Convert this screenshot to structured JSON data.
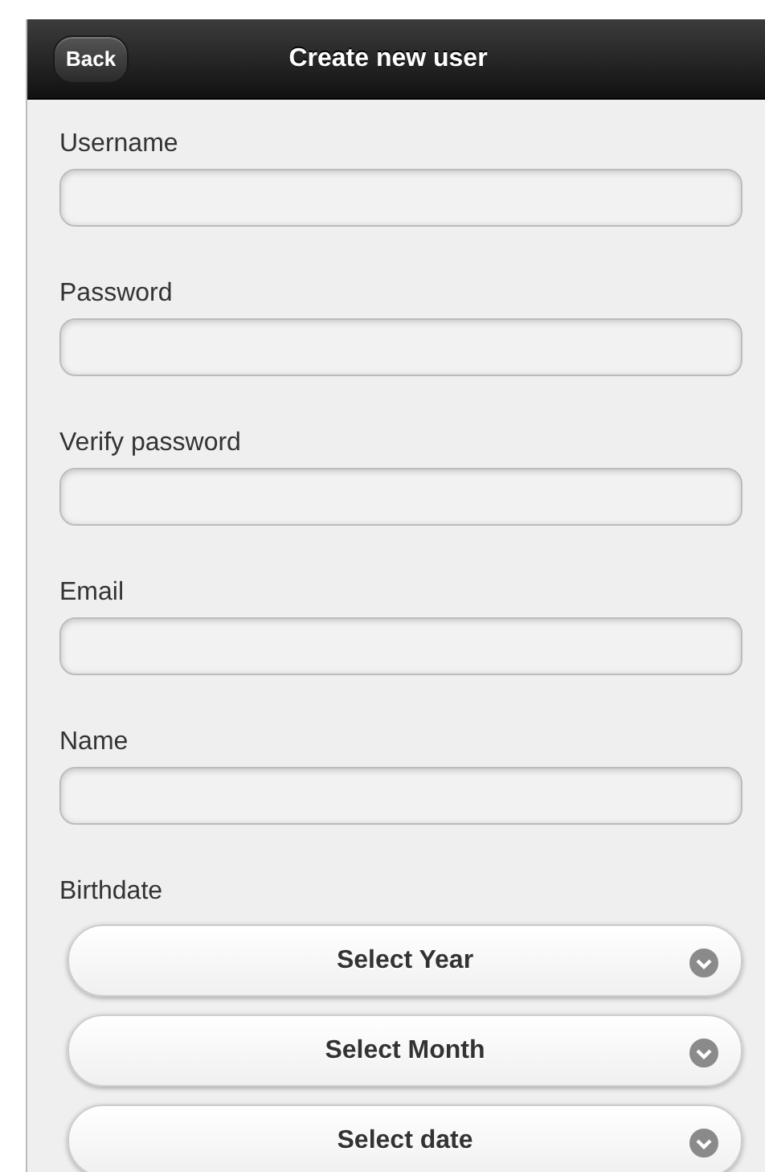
{
  "header": {
    "back_button": "Back",
    "title": "Create new user"
  },
  "fields": [
    {
      "label": "Username"
    },
    {
      "label": "Password"
    },
    {
      "label": "Verify password"
    },
    {
      "label": "Email"
    },
    {
      "label": "Name"
    }
  ],
  "birthdate": {
    "label": "Birthdate",
    "selects": [
      {
        "label": "Select Year"
      },
      {
        "label": "Select Month"
      },
      {
        "label": "Select date"
      }
    ]
  }
}
